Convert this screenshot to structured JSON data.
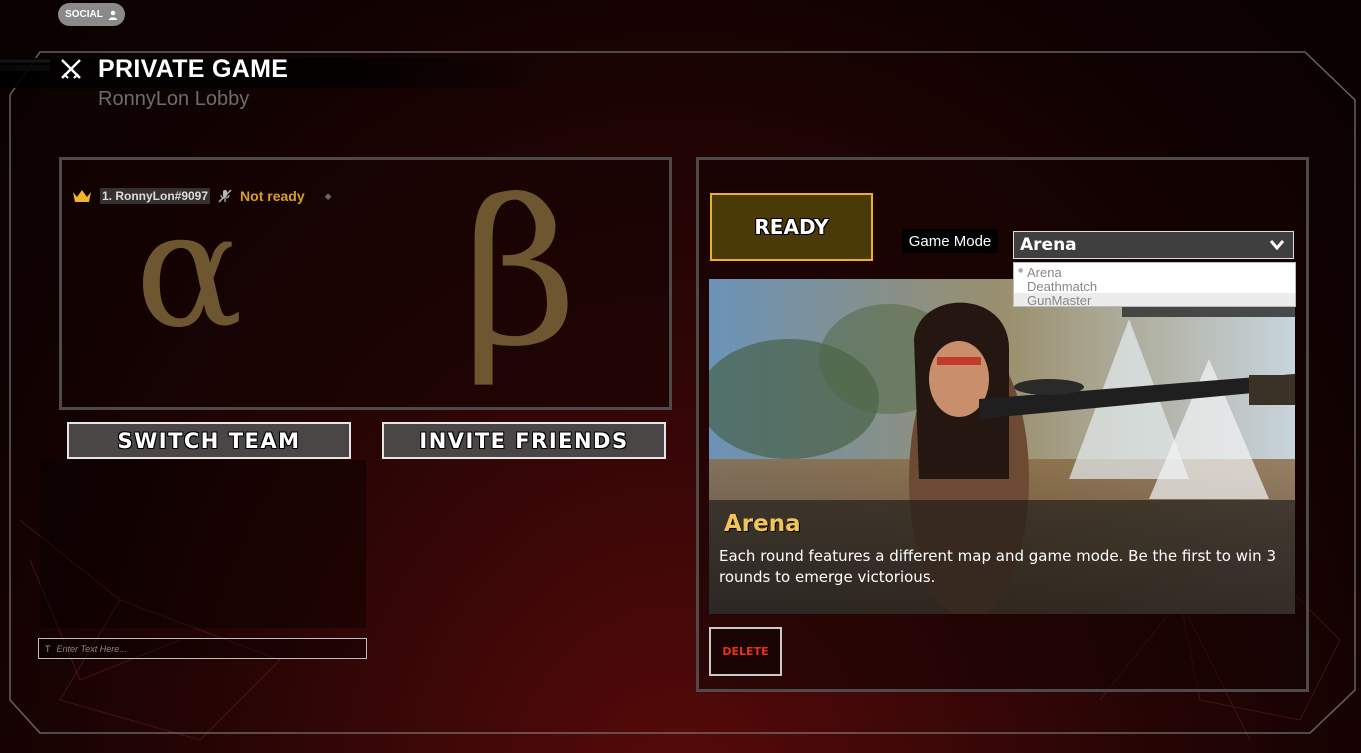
{
  "social": {
    "label": "SOCIAL",
    "icon": "person-icon"
  },
  "header": {
    "title": "PRIVATE GAME",
    "subtitle": "RonnyLon Lobby",
    "icon": "crossed-swords-icon"
  },
  "lobby": {
    "players": [
      {
        "rank_icon": "crown-icon",
        "name": "1. RonnyLon#9097",
        "status_icon": "muted-mic-icon",
        "status": "Not ready",
        "extra": "◆"
      }
    ],
    "team_alpha": "α",
    "team_beta": "β"
  },
  "buttons": {
    "switch_team": "SWITCH TEAM",
    "invite_friends": "INVITE FRIENDS",
    "ready": "READY",
    "delete": "DELETE"
  },
  "chat": {
    "placeholder": "Enter Text Here...",
    "input_icon": "T"
  },
  "game_mode": {
    "label": "Game Mode",
    "selected": "Arena",
    "options": [
      "Arena",
      "Deathmatch",
      "GunMaster"
    ]
  },
  "map": {
    "title": "Arena",
    "description": "Each round features a different map and game mode. Be the first to win 3 rounds to emerge victorious."
  },
  "colors": {
    "accent_gold": "#e7b322",
    "status_gold": "#d9a21f",
    "delete_red": "#e4331a",
    "team_greek": "#6e5630"
  }
}
